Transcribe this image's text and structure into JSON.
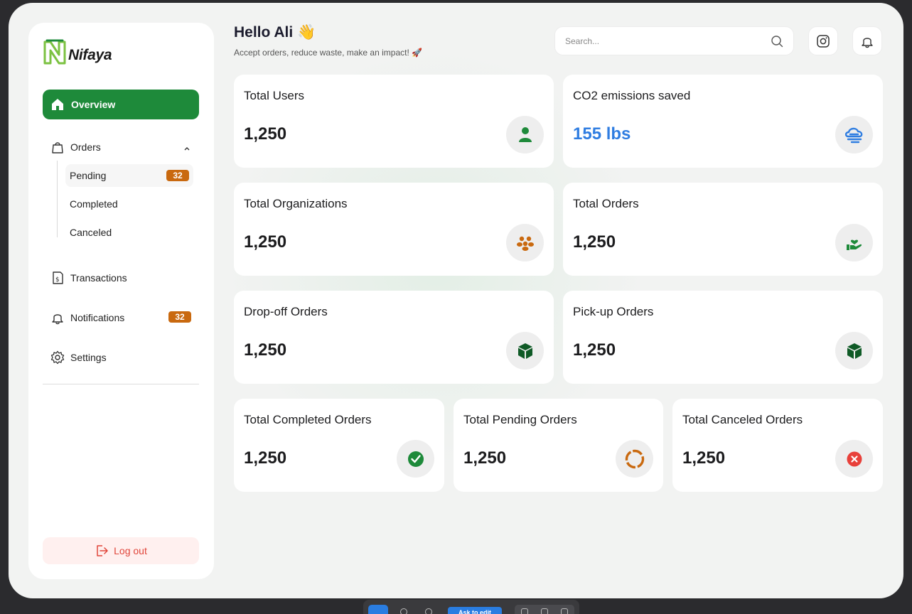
{
  "brand": {
    "name": "Nifaya",
    "accent": "#1e8a3a"
  },
  "sidebar": {
    "overview": "Overview",
    "orders": {
      "label": "Orders",
      "sub": [
        {
          "label": "Pending",
          "badge": "32"
        },
        {
          "label": "Completed"
        },
        {
          "label": "Canceled"
        }
      ]
    },
    "transactions": "Transactions",
    "notifications": {
      "label": "Notifications",
      "badge": "32"
    },
    "settings": "Settings",
    "logout": "Log out"
  },
  "header": {
    "greeting": "Hello Ali 👋",
    "tagline": "Accept orders, reduce waste, make an impact! 🚀",
    "search_placeholder": "Search..."
  },
  "cards": {
    "users": {
      "title": "Total Users",
      "value": "1,250",
      "icon": "user-icon"
    },
    "co2": {
      "title": "CO2 emissions saved",
      "value": "155 lbs",
      "icon": "cloud-wind-icon"
    },
    "orgs": {
      "title": "Total Organizations",
      "value": "1,250",
      "icon": "users-group-icon"
    },
    "orders": {
      "title": "Total Orders",
      "value": "1,250",
      "icon": "hand-heart-icon"
    },
    "dropoff": {
      "title": "Drop-off Orders",
      "value": "1,250",
      "icon": "box-icon"
    },
    "pickup": {
      "title": "Pick-up Orders",
      "value": "1,250",
      "icon": "box-icon"
    },
    "completed": {
      "title": "Total Completed Orders",
      "value": "1,250",
      "icon": "check-circle-icon"
    },
    "pending": {
      "title": "Total Pending Orders",
      "value": "1,250",
      "icon": "spinner-icon"
    },
    "canceled": {
      "title": "Total Canceled Orders",
      "value": "1,250",
      "icon": "x-circle-icon"
    }
  },
  "toolbar": {
    "edit_button": "Ask to edit"
  },
  "colors": {
    "green": "#1e8a3a",
    "orange": "#c9690f",
    "blue": "#2f7de1",
    "red": "#e0453a",
    "dark_green": "#0f5a26"
  }
}
